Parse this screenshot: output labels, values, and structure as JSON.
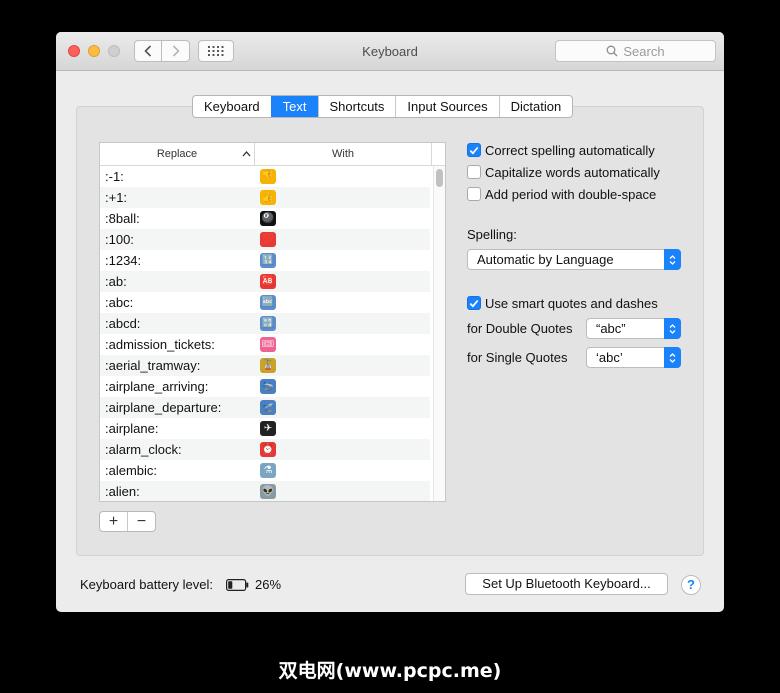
{
  "window": {
    "title": "Keyboard"
  },
  "search": {
    "placeholder": "Search",
    "icon": "magnifier-icon"
  },
  "tabs": [
    {
      "label": "Keyboard",
      "active": false
    },
    {
      "label": "Text",
      "active": true
    },
    {
      "label": "Shortcuts",
      "active": false
    },
    {
      "label": "Input Sources",
      "active": false
    },
    {
      "label": "Dictation",
      "active": false
    }
  ],
  "table": {
    "columns": {
      "replace": "Replace",
      "with": "With"
    },
    "rows": [
      {
        "replace": ":-1:",
        "with": "👎",
        "icon": "thumbs-down-icon",
        "color": "#f4b400"
      },
      {
        "replace": ":+1:",
        "with": "👍",
        "icon": "thumbs-up-icon",
        "color": "#f4b400"
      },
      {
        "replace": ":8ball:",
        "with": "🎱",
        "icon": "8ball-icon",
        "color": "#111111"
      },
      {
        "replace": ":100:",
        "with": "💯",
        "icon": "hundred-icon",
        "color": "#e53935"
      },
      {
        "replace": ":1234:",
        "with": "🔢",
        "icon": "numbers-icon",
        "color": "#5b8cd6"
      },
      {
        "replace": ":ab:",
        "with": "🆎",
        "icon": "ab-icon",
        "color": "#e53935"
      },
      {
        "replace": ":abc:",
        "with": "🔤",
        "icon": "abc-icon",
        "color": "#5b8cd6"
      },
      {
        "replace": ":abcd:",
        "with": "🔡",
        "icon": "abcd-icon",
        "color": "#5b8cd6"
      },
      {
        "replace": ":admission_tickets:",
        "with": "🎟",
        "icon": "tickets-icon",
        "color": "#f06292"
      },
      {
        "replace": ":aerial_tramway:",
        "with": "🚡",
        "icon": "tramway-icon",
        "color": "#c9a227"
      },
      {
        "replace": ":airplane_arriving:",
        "with": "🛬",
        "icon": "airplane-arriving-icon",
        "color": "#4a7fc1"
      },
      {
        "replace": ":airplane_departure:",
        "with": "🛫",
        "icon": "airplane-departure-icon",
        "color": "#4a7fc1"
      },
      {
        "replace": ":airplane:",
        "with": "✈",
        "icon": "airplane-icon",
        "color": "#222222"
      },
      {
        "replace": ":alarm_clock:",
        "with": "⏰",
        "icon": "alarm-clock-icon",
        "color": "#e53935"
      },
      {
        "replace": ":alembic:",
        "with": "⚗",
        "icon": "alembic-icon",
        "color": "#7aa6c2"
      },
      {
        "replace": ":alien:",
        "with": "👽",
        "icon": "alien-icon",
        "color": "#8a9aa3"
      }
    ]
  },
  "options": {
    "correct_spelling": {
      "label": "Correct spelling automatically",
      "checked": true
    },
    "capitalize_words": {
      "label": "Capitalize words automatically",
      "checked": false
    },
    "add_period": {
      "label": "Add period with double-space",
      "checked": false
    },
    "spelling_label": "Spelling:",
    "spelling_value": "Automatic by Language",
    "smart_quotes": {
      "label": "Use smart quotes and dashes",
      "checked": true
    },
    "double_quotes_label": "for Double Quotes",
    "double_quotes_value": "“abc”",
    "single_quotes_label": "for Single Quotes",
    "single_quotes_value": "‘abc’"
  },
  "footer": {
    "battery_label": "Keyboard battery level:",
    "battery_value": "26%",
    "battery_level": 0.26,
    "bluetooth_button": "Set Up Bluetooth Keyboard...",
    "help": "?"
  },
  "watermark": "双电网(www.pcpc.me)",
  "colors": {
    "accent": "#1a82fb"
  }
}
